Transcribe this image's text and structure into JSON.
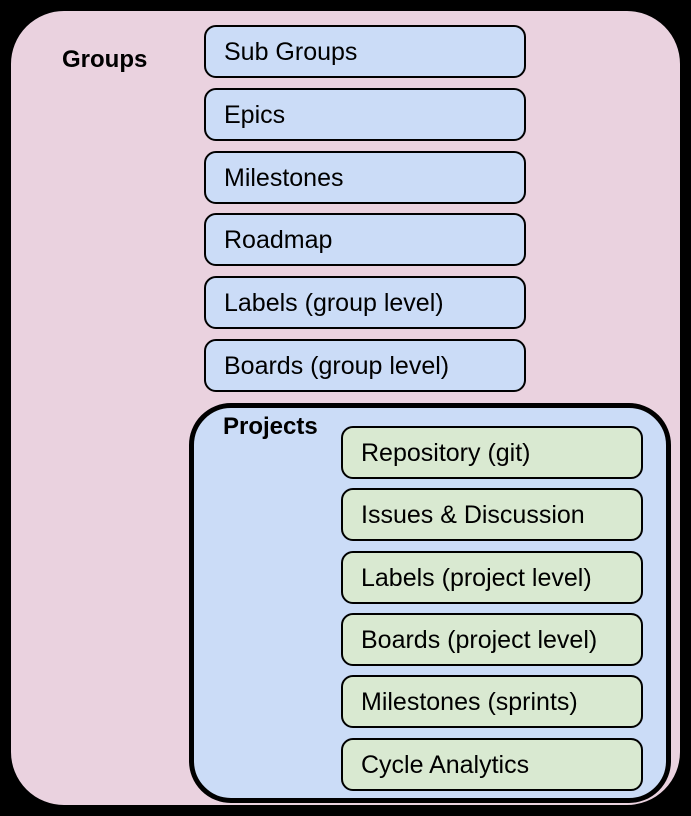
{
  "diagram": {
    "type": "nested-container-diagram",
    "background_color": "#000000",
    "outer": {
      "label": "Groups",
      "fill_color": "#EAD2DF",
      "border_color": "#000000",
      "items": [
        {
          "label": "Sub Groups",
          "fill_color": "#CBDCF7"
        },
        {
          "label": "Epics",
          "fill_color": "#CBDCF7"
        },
        {
          "label": "Milestones",
          "fill_color": "#CBDCF7"
        },
        {
          "label": "Roadmap",
          "fill_color": "#CBDCF7"
        },
        {
          "label": "Labels (group level)",
          "fill_color": "#CBDCF7"
        },
        {
          "label": "Boards (group level)",
          "fill_color": "#CBDCF7"
        }
      ]
    },
    "inner": {
      "label": "Projects",
      "fill_color": "#CBDCF7",
      "border_color": "#000000",
      "items": [
        {
          "label": "Repository (git)",
          "fill_color": "#D9E9D1"
        },
        {
          "label": "Issues & Discussion",
          "fill_color": "#D9E9D1"
        },
        {
          "label": "Labels (project level)",
          "fill_color": "#D9E9D1"
        },
        {
          "label": "Boards (project level)",
          "fill_color": "#D9E9D1"
        },
        {
          "label": "Milestones (sprints)",
          "fill_color": "#D9E9D1"
        },
        {
          "label": "Cycle Analytics",
          "fill_color": "#D9E9D1"
        }
      ]
    }
  }
}
